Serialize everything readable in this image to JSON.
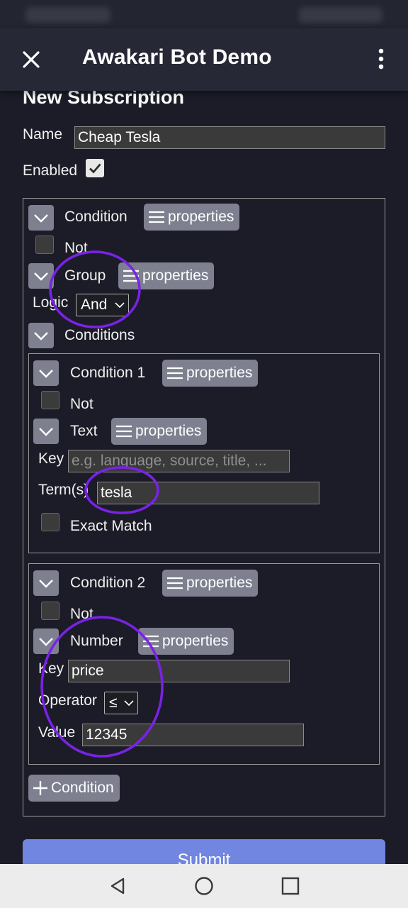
{
  "app": {
    "title": "Awakari Bot Demo"
  },
  "form": {
    "heading": "New Subscription",
    "name_label": "Name",
    "name_value": "Cheap Tesla",
    "enabled_label": "Enabled",
    "enabled": true
  },
  "root": {
    "condition_label": "Condition",
    "properties_label": "properties",
    "not_label": "Not",
    "group_label": "Group",
    "logic_label": "Logic",
    "logic_value": "And",
    "conditions_label": "Conditions"
  },
  "condition1": {
    "title": "Condition 1",
    "properties_label": "properties",
    "not_label": "Not",
    "type_label": "Text",
    "key_label": "Key",
    "key_placeholder": "e.g. language, source, title, ...",
    "terms_label": "Term(s)",
    "terms_value": "tesla",
    "exact_label": "Exact Match"
  },
  "condition2": {
    "title": "Condition 2",
    "properties_label": "properties",
    "not_label": "Not",
    "type_label": "Number",
    "key_label": "Key",
    "key_value": "price",
    "operator_label": "Operator",
    "operator_value": "≤",
    "value_label": "Value",
    "value_value": "12345"
  },
  "actions": {
    "add_condition_label": "Condition",
    "submit_label": "Submit"
  },
  "colors": {
    "accent_button": "#7e8090",
    "submit": "#7186e0",
    "annotation": "#7a22e8"
  }
}
